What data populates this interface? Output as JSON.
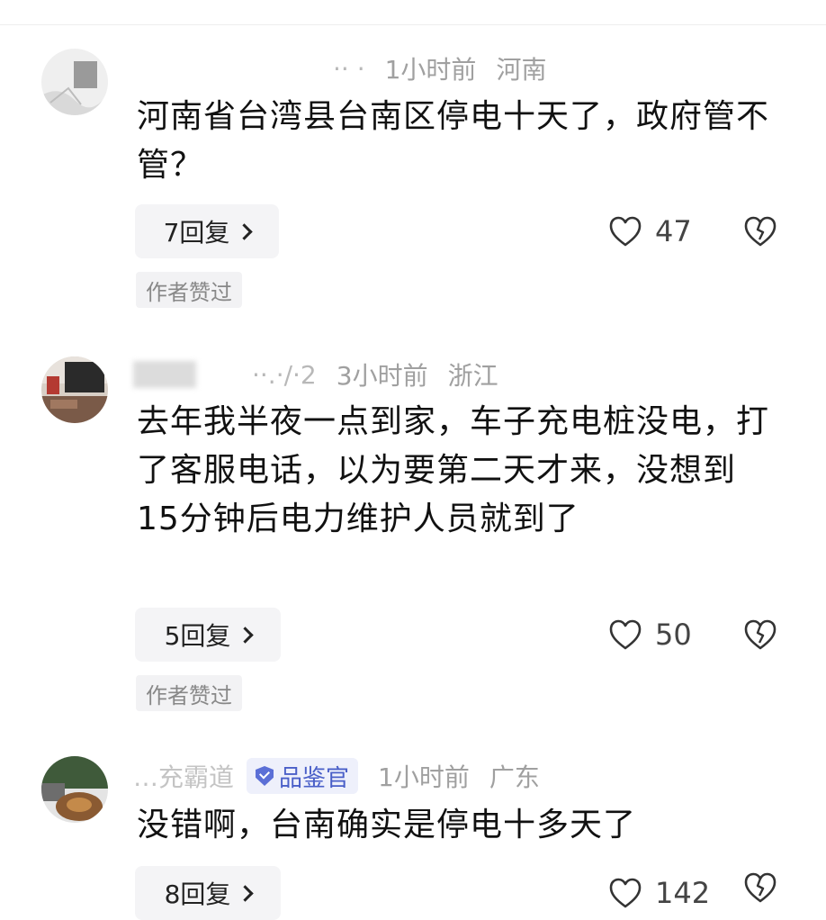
{
  "comments": [
    {
      "username": "·· ·",
      "time": "1小时前",
      "location": "河南",
      "text": "河南省台湾县台南区停电十天了，政府管不管？",
      "replies": "7回复",
      "likes": "47",
      "author_liked": "作者赞过"
    },
    {
      "username": "··.·/·2",
      "time": "3小时前",
      "location": "浙江",
      "text": "去年我半夜一点到家，车子充电桩没电，打了客服电话，以为要第二天才来，没想到15分钟后电力维护人员就到了",
      "replies": "5回复",
      "likes": "50",
      "author_liked": "作者赞过"
    },
    {
      "username": "…充霸道",
      "badge": "品鉴官",
      "time": "1小时前",
      "location": "广东",
      "text": "没错啊，台南确实是停电十多天了",
      "replies": "8回复",
      "likes": "142"
    }
  ],
  "colors": {
    "text": "#111111",
    "meta": "#a0a0a0",
    "badge_bg": "#eef0fb",
    "badge_fg": "#4a5fc8",
    "button_bg": "#f4f4f6"
  },
  "icons": {
    "like": "heart-outline-icon",
    "dislike": "broken-heart-icon",
    "badge": "shield-check-icon",
    "reply_chevron": "chevron-right-icon"
  }
}
